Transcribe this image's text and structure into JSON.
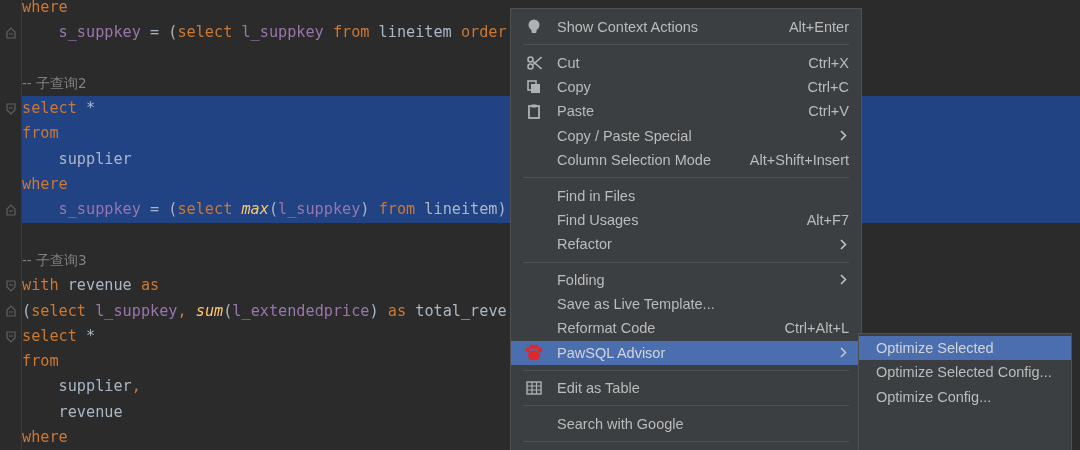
{
  "editor": {
    "lines": [
      {
        "selected": false,
        "indent": false,
        "fold_start": false,
        "fold_end": false,
        "tokens": [
          {
            "kind": "keyword",
            "text": "where"
          }
        ]
      },
      {
        "selected": false,
        "indent": true,
        "fold_start": false,
        "fold_end": true,
        "tokens": [
          {
            "kind": "column",
            "text": "s_suppkey"
          },
          {
            "kind": "plain",
            "text": " = ("
          },
          {
            "kind": "keyword",
            "text": "select "
          },
          {
            "kind": "column",
            "text": "l_suppkey "
          },
          {
            "kind": "keyword",
            "text": "from"
          },
          {
            "kind": "plain",
            "text": " lineitem "
          },
          {
            "kind": "keyword",
            "text": "order"
          }
        ]
      },
      {
        "selected": false,
        "fold_start": false,
        "fold_end": false
      },
      {
        "selected": false,
        "indent": false,
        "fold_start": false,
        "fold_end": false,
        "tokens": [
          {
            "kind": "comment",
            "text": "-- 子查询2"
          }
        ]
      },
      {
        "selected": true,
        "indent": false,
        "fold_start": true,
        "fold_end": false,
        "tokens": [
          {
            "kind": "keyword",
            "text": "select"
          },
          {
            "kind": "plain",
            "text": " *"
          }
        ]
      },
      {
        "selected": true,
        "indent": false,
        "fold_start": false,
        "fold_end": false,
        "tokens": [
          {
            "kind": "keyword",
            "text": "from"
          }
        ]
      },
      {
        "selected": true,
        "indent": true,
        "fold_start": false,
        "fold_end": false,
        "tokens": [
          {
            "kind": "plain",
            "text": "supplier"
          }
        ]
      },
      {
        "selected": true,
        "indent": false,
        "fold_start": false,
        "fold_end": false,
        "tokens": [
          {
            "kind": "keyword",
            "text": "where"
          }
        ]
      },
      {
        "selected": true,
        "indent": true,
        "fold_start": false,
        "fold_end": true,
        "tokens": [
          {
            "kind": "column",
            "text": "s_suppkey"
          },
          {
            "kind": "plain",
            "text": " = ("
          },
          {
            "kind": "keyword",
            "text": "select "
          },
          {
            "kind": "function",
            "text": "max"
          },
          {
            "kind": "plain",
            "text": "("
          },
          {
            "kind": "column",
            "text": "l_suppkey"
          },
          {
            "kind": "plain",
            "text": ") "
          },
          {
            "kind": "keyword",
            "text": "from"
          },
          {
            "kind": "plain",
            "text": " lineitem)"
          }
        ]
      },
      {
        "selected": false,
        "fold_start": false,
        "fold_end": false
      },
      {
        "selected": false,
        "indent": false,
        "fold_start": false,
        "fold_end": false,
        "tokens": [
          {
            "kind": "comment",
            "text": "-- 子查询3"
          }
        ]
      },
      {
        "selected": false,
        "indent": false,
        "fold_start": true,
        "fold_end": false,
        "tokens": [
          {
            "kind": "keyword",
            "text": "with"
          },
          {
            "kind": "plain",
            "text": " revenue "
          },
          {
            "kind": "keyword",
            "text": "as"
          }
        ]
      },
      {
        "selected": false,
        "indent": false,
        "fold_start": false,
        "fold_end": true,
        "tokens": [
          {
            "kind": "plain",
            "text": "("
          },
          {
            "kind": "keyword",
            "text": "select "
          },
          {
            "kind": "column",
            "text": "l_suppkey"
          },
          {
            "kind": "keyword",
            "text": ", "
          },
          {
            "kind": "function",
            "text": "sum"
          },
          {
            "kind": "plain",
            "text": "("
          },
          {
            "kind": "column",
            "text": "l_extendedprice"
          },
          {
            "kind": "plain",
            "text": ") "
          },
          {
            "kind": "keyword",
            "text": "as"
          },
          {
            "kind": "plain",
            "text": " total_reve"
          }
        ]
      },
      {
        "selected": false,
        "indent": false,
        "fold_start": true,
        "fold_end": false,
        "tokens": [
          {
            "kind": "keyword",
            "text": "select"
          },
          {
            "kind": "plain",
            "text": " *"
          }
        ]
      },
      {
        "selected": false,
        "indent": false,
        "fold_start": false,
        "fold_end": false,
        "tokens": [
          {
            "kind": "keyword",
            "text": "from"
          }
        ]
      },
      {
        "selected": false,
        "indent": true,
        "fold_start": false,
        "fold_end": false,
        "tokens": [
          {
            "kind": "plain",
            "text": "supplier"
          },
          {
            "kind": "keyword",
            "text": ","
          }
        ]
      },
      {
        "selected": false,
        "indent": true,
        "fold_start": false,
        "fold_end": false,
        "tokens": [
          {
            "kind": "plain",
            "text": "revenue"
          }
        ]
      },
      {
        "selected": false,
        "indent": false,
        "fold_start": false,
        "fold_end": false,
        "tokens": [
          {
            "kind": "keyword",
            "text": "where"
          }
        ]
      }
    ]
  },
  "context_menu": {
    "items": [
      {
        "kind": "context-actions",
        "label": "Show Context Actions",
        "shortcut": "Alt+Enter",
        "submenu": false,
        "selected": false
      },
      {
        "kind": "separator"
      },
      {
        "kind": "cut",
        "label": "Cut",
        "shortcut": "Ctrl+X",
        "submenu": false,
        "selected": false
      },
      {
        "kind": "copy",
        "label": "Copy",
        "shortcut": "Ctrl+C",
        "submenu": false,
        "selected": false
      },
      {
        "kind": "paste",
        "label": "Paste",
        "shortcut": "Ctrl+V",
        "submenu": false,
        "selected": false
      },
      {
        "kind": "item",
        "label": "Copy / Paste Special",
        "submenu": true,
        "selected": false
      },
      {
        "kind": "item",
        "label": "Column Selection Mode",
        "shortcut": "Alt+Shift+Insert",
        "submenu": false,
        "selected": false
      },
      {
        "kind": "separator"
      },
      {
        "kind": "item",
        "label": "Find in Files",
        "submenu": false,
        "selected": false
      },
      {
        "kind": "item",
        "label": "Find Usages",
        "shortcut": "Alt+F7",
        "submenu": false,
        "selected": false
      },
      {
        "kind": "item",
        "label": "Refactor",
        "submenu": true,
        "selected": false
      },
      {
        "kind": "separator"
      },
      {
        "kind": "item",
        "label": "Folding",
        "submenu": true,
        "selected": false
      },
      {
        "kind": "item",
        "label": "Save as Live Template...",
        "submenu": false,
        "selected": false
      },
      {
        "kind": "item",
        "label": "Reformat Code",
        "shortcut": "Ctrl+Alt+L",
        "submenu": false,
        "selected": false
      },
      {
        "kind": "plugin",
        "label": "PawSQL Advisor",
        "submenu": true,
        "selected": true
      },
      {
        "kind": "separator"
      },
      {
        "kind": "table",
        "label": "Edit as Table",
        "submenu": false,
        "selected": false
      },
      {
        "kind": "separator"
      },
      {
        "kind": "item",
        "label": "Search with Google",
        "submenu": false,
        "selected": false
      },
      {
        "kind": "separator"
      }
    ]
  },
  "submenu": {
    "items": [
      {
        "label": "Optimize Selected",
        "selected": true
      },
      {
        "label": "Optimize Selected Config...",
        "selected": false
      },
      {
        "label": "Optimize Config...",
        "selected": false
      }
    ]
  }
}
